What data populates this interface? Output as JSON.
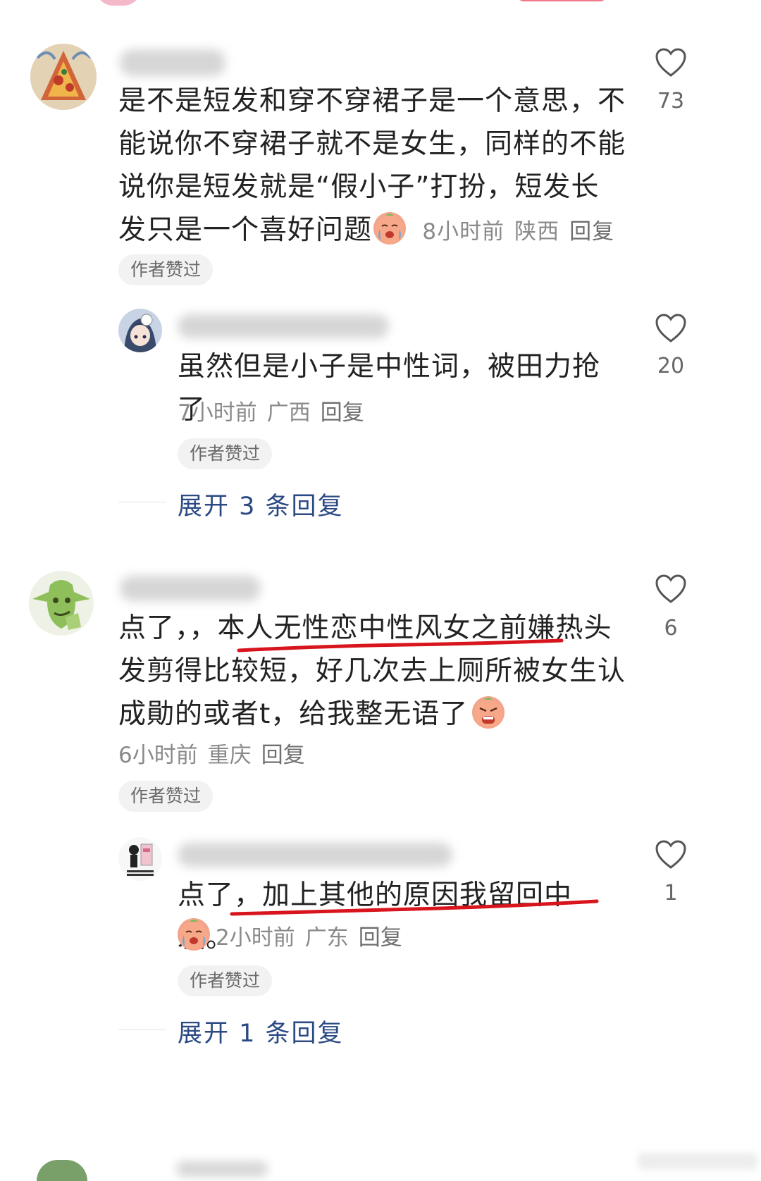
{
  "comments": [
    {
      "text": "是不是短发和穿不穿裙子是一个意思，不能说你不穿裙子就不是女生，同样的不能说你是短发就是“假小子”打扮，短发长发只是一个喜好问题",
      "time": "8小时前",
      "location": "陕西",
      "reply_label": "回复",
      "badge": "作者赞过",
      "likes": "73",
      "reply": {
        "text": "虽然但是小子是中性词，被田力抢了",
        "time": "7小时前",
        "location": "广西",
        "reply_label": "回复",
        "badge": "作者赞过",
        "likes": "20"
      },
      "expand_label": "展开 3 条回复"
    },
    {
      "text_before_underline": "点了，，",
      "text_underlined": "本人无性恋中性风女之前嫌热",
      "text_after_underline": "头发剪得比较短，好几次去上厕所被女生认成勛的或者t，给我整无语了",
      "time": "6小时前",
      "location": "重庆",
      "reply_label": "回复",
      "badge": "作者赞过",
      "likes": "6",
      "reply": {
        "text_before_underline": "点了，",
        "text_underlined": "加上其他的原因我留回中发。",
        "time": "2小时前",
        "location": "广东",
        "reply_label": "回复",
        "badge": "作者赞过",
        "likes": "1"
      },
      "expand_label": "展开 1 条回复"
    }
  ],
  "colors": {
    "link": "#2b4a83",
    "underline": "#d8141c",
    "meta": "#8a8a8a",
    "badge_bg": "#f2f2f2"
  },
  "icons": [
    "heart-outline-icon",
    "crying-emoji-icon",
    "angry-emoji-icon"
  ]
}
